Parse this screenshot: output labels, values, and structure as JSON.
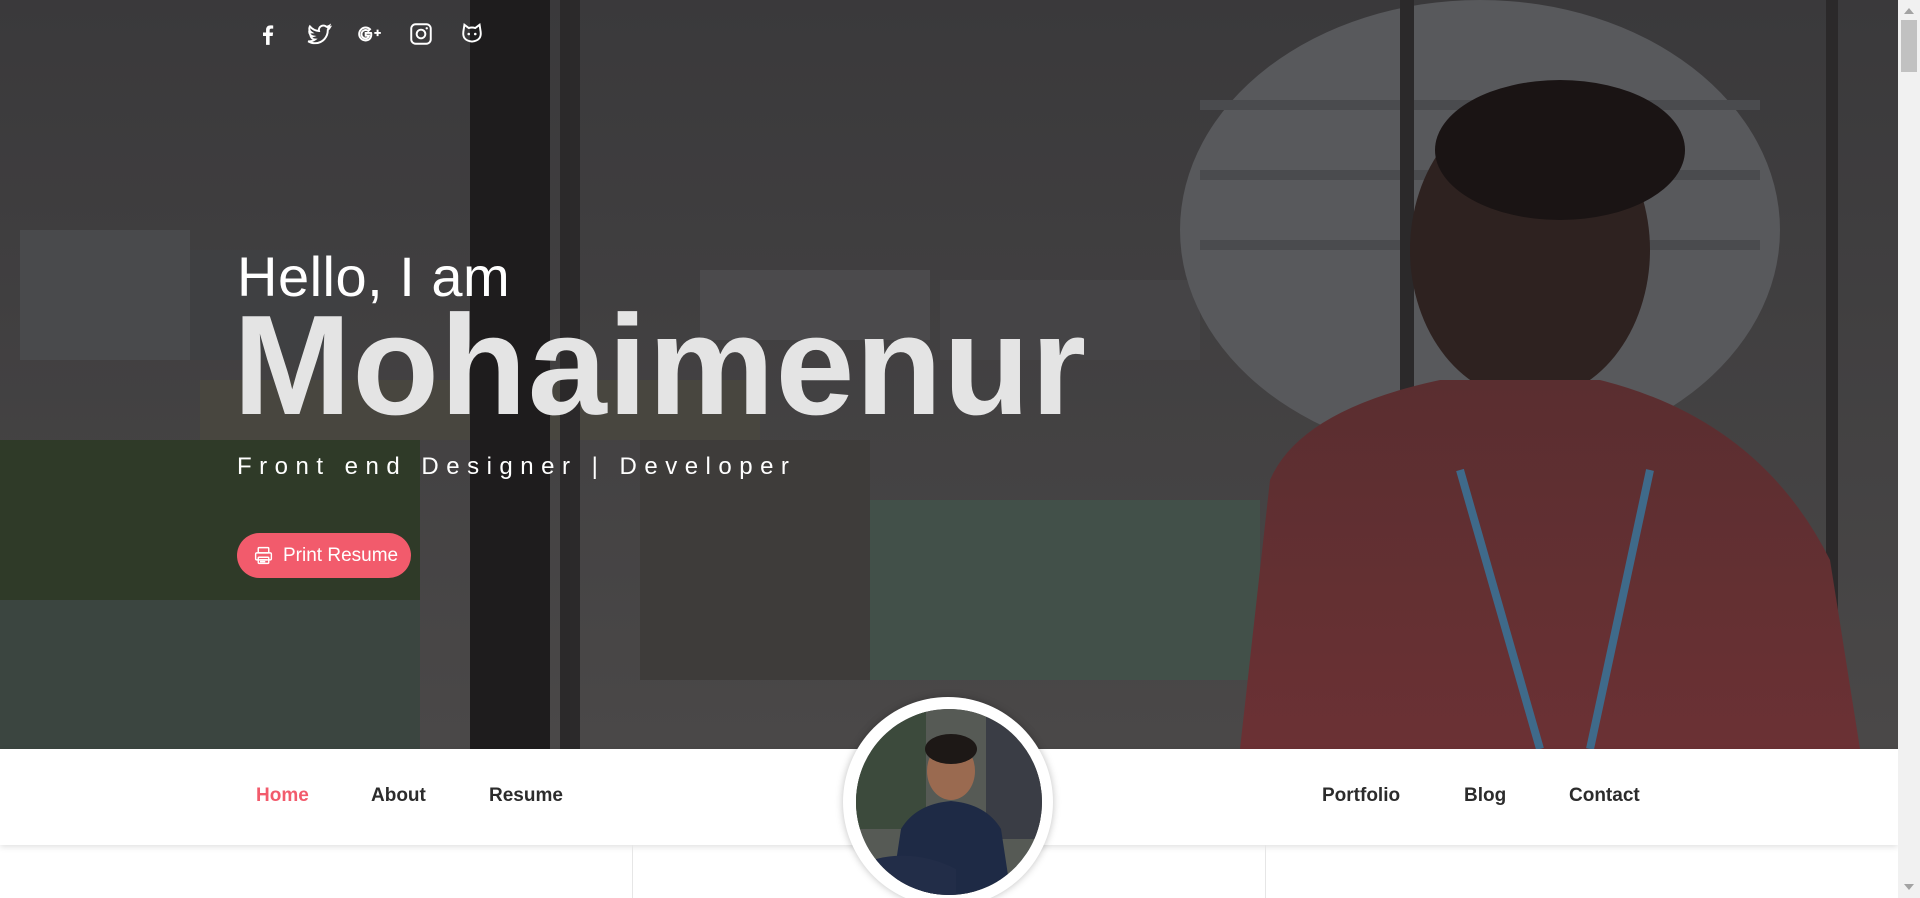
{
  "social": {
    "icons": [
      "facebook-icon",
      "twitter-icon",
      "google-plus-icon",
      "instagram-icon",
      "github-icon"
    ]
  },
  "hero": {
    "greeting": "Hello, I am",
    "name": "Mohaimenur",
    "role": "Front end Designer | Developer",
    "print_button_label": "Print Resume",
    "print_icon": "printer-icon"
  },
  "nav": {
    "home": "Home",
    "about": "About",
    "resume": "Resume",
    "portfolio": "Portfolio",
    "blog": "Blog",
    "contact": "Contact",
    "active": "Home"
  },
  "colors": {
    "accent": "#f25b6c",
    "nav_text": "#2c2c2c",
    "hero_overlay": "#3e3c3d"
  }
}
